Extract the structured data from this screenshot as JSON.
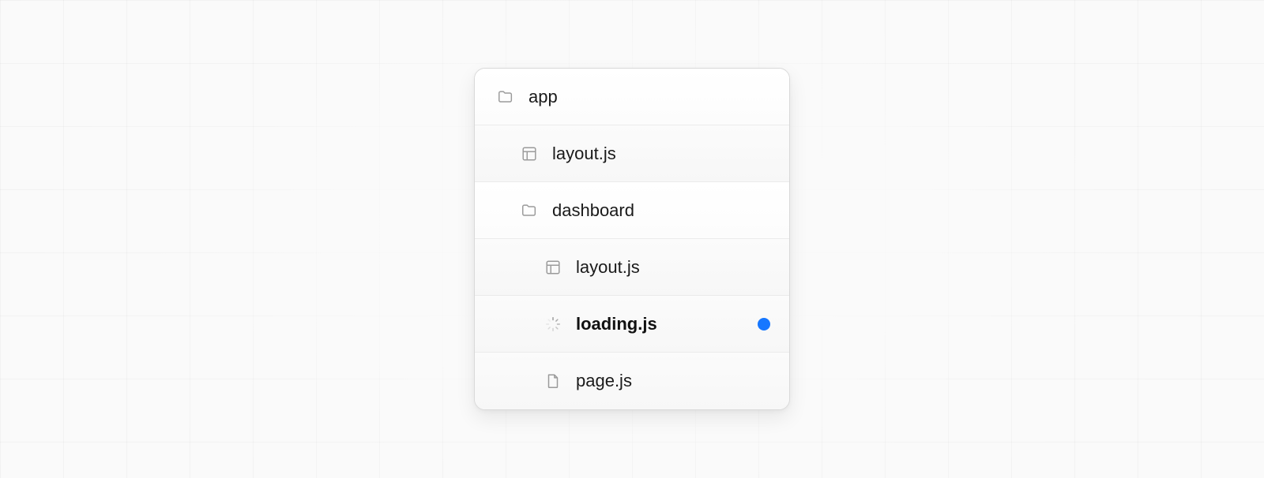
{
  "tree": {
    "rows": [
      {
        "label": "app",
        "icon": "folder",
        "indent": 0,
        "bold": false,
        "highlighted": false,
        "shaded": false
      },
      {
        "label": "layout.js",
        "icon": "layout",
        "indent": 1,
        "bold": false,
        "highlighted": false,
        "shaded": true
      },
      {
        "label": "dashboard",
        "icon": "folder",
        "indent": 1,
        "bold": false,
        "highlighted": false,
        "shaded": false
      },
      {
        "label": "layout.js",
        "icon": "layout",
        "indent": 2,
        "bold": false,
        "highlighted": false,
        "shaded": true
      },
      {
        "label": "loading.js",
        "icon": "spinner",
        "indent": 2,
        "bold": true,
        "highlighted": true,
        "shaded": true
      },
      {
        "label": "page.js",
        "icon": "file",
        "indent": 2,
        "bold": false,
        "highlighted": false,
        "shaded": true
      }
    ]
  },
  "colors": {
    "highlight_dot": "#1677ff",
    "icon": "#9a9a9a",
    "border": "#ebebeb"
  }
}
